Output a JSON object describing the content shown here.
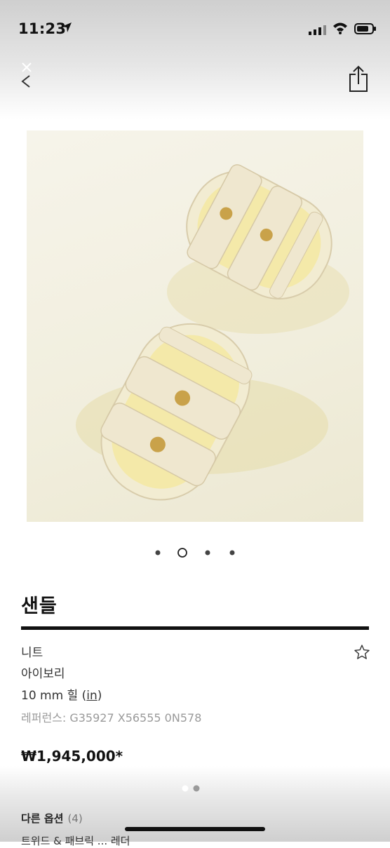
{
  "status_bar": {
    "time": "11:23"
  },
  "product": {
    "title": "샌들",
    "material": "니트",
    "color": "아이보리",
    "heel_prefix": "10 mm 힐 (",
    "heel_unit": "in",
    "heel_suffix": ")",
    "reference": "레퍼런스: G35927 X56555 0N578",
    "price": "₩1,945,000*"
  },
  "image_carousel": {
    "total": 4,
    "active_index": 1
  },
  "options": {
    "label": "다른 옵션",
    "count": "(4)"
  },
  "cut_off_text": "트위드 & 패브릭  ...  레더",
  "colors": {
    "text": "#111111",
    "muted": "#9a9a9a",
    "sandal": "#f5efd6",
    "gold": "#c9a24a"
  }
}
